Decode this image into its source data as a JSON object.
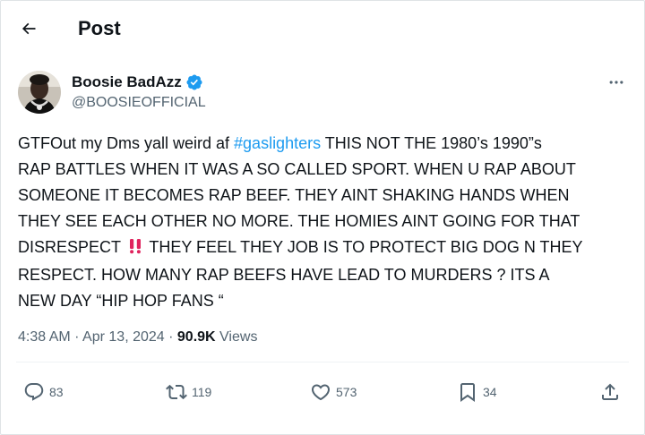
{
  "header": {
    "title": "Post"
  },
  "author": {
    "display_name": "Boosie BadAzz",
    "handle": "@BOOSIEOFFICIAL",
    "verified": true
  },
  "tweet": {
    "lines": [
      [
        "GTFOut my Dms yall weird af ",
        "#gaslighters",
        " THIS NOT THE 1980’s 1990”s"
      ],
      "RAP BATTLES WHEN IT WAS A SO CALLED SPORT. WHEN U RAP ABOUT",
      "SOMEONE IT BECOMES RAP BEEF. THEY AINT SHAKING HANDS WHEN",
      "THEY SEE EACH OTHER NO MORE. THE HOMIES AINT GOING FOR THAT",
      [
        "DISRESPECT ",
        "!!",
        " THEY FEEL THEY JOB IS TO PROTECT BIG DOG N THEY"
      ],
      "RESPECT. HOW MANY RAP BEEFS HAVE LEAD TO MURDERS ? ITS A",
      "NEW DAY “HIP HOP FANS “"
    ]
  },
  "meta": {
    "time": "4:38 AM",
    "separator": " · ",
    "date": "Apr 13, 2024",
    "views_count": "90.9K",
    "views_label": "Views"
  },
  "actions": {
    "replies": "83",
    "reposts": "119",
    "likes": "573",
    "bookmarks": "34"
  },
  "colors": {
    "accent": "#1d9bf0",
    "text": "#0f1419",
    "secondary": "#536471",
    "emoji_red": "#e0245e"
  },
  "icons": [
    "back-arrow-icon",
    "verified-badge-icon",
    "more-icon",
    "reply-icon",
    "repost-icon",
    "like-icon",
    "bookmark-icon",
    "share-icon"
  ]
}
